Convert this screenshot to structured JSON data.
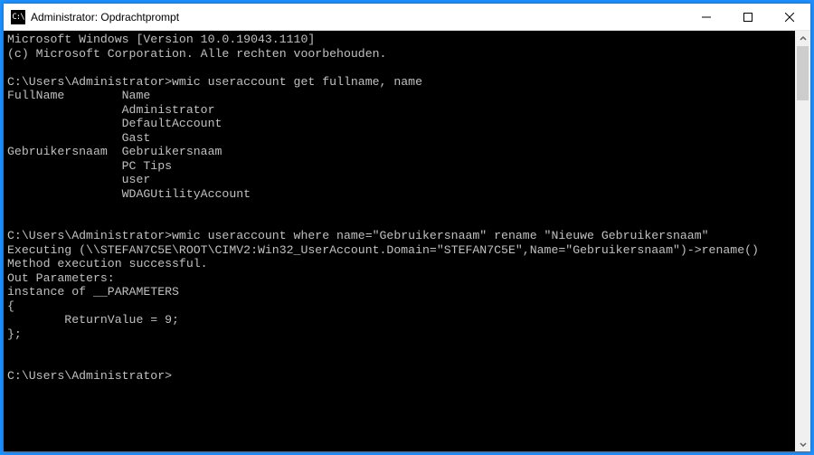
{
  "titlebar": {
    "icon_glyph": "C:\\",
    "title": "Administrator: Opdrachtprompt"
  },
  "terminal": {
    "banner1": "Microsoft Windows [Version 10.0.19043.1110]",
    "banner2": "(c) Microsoft Corporation. Alle rechten voorbehouden.",
    "prompt1_path": "C:\\Users\\Administrator>",
    "prompt1_cmd": "wmic useraccount get fullname, name",
    "header_fullname": "FullName",
    "header_name": "Name",
    "accounts": [
      {
        "fullname": "",
        "name": "Administrator"
      },
      {
        "fullname": "",
        "name": "DefaultAccount"
      },
      {
        "fullname": "",
        "name": "Gast"
      },
      {
        "fullname": "Gebruikersnaam",
        "name": "Gebruikersnaam"
      },
      {
        "fullname": "",
        "name": "PC Tips"
      },
      {
        "fullname": "",
        "name": "user"
      },
      {
        "fullname": "",
        "name": "WDAGUtilityAccount"
      }
    ],
    "prompt2_path": "C:\\Users\\Administrator>",
    "prompt2_cmd": "wmic useraccount where name=\"Gebruikersnaam\" rename \"Nieuwe Gebruikersnaam\"",
    "exec_line": "Executing (\\\\STEFAN7C5E\\ROOT\\CIMV2:Win32_UserAccount.Domain=\"STEFAN7C5E\",Name=\"Gebruikersnaam\")->rename()",
    "method_line": "Method execution successful.",
    "out_params": "Out Parameters:",
    "instance_line": "instance of __PARAMETERS",
    "brace_open": "{",
    "return_line": "        ReturnValue = 9;",
    "brace_close": "};",
    "prompt3_path": "C:\\Users\\Administrator>",
    "col1_width_ch": 16
  }
}
